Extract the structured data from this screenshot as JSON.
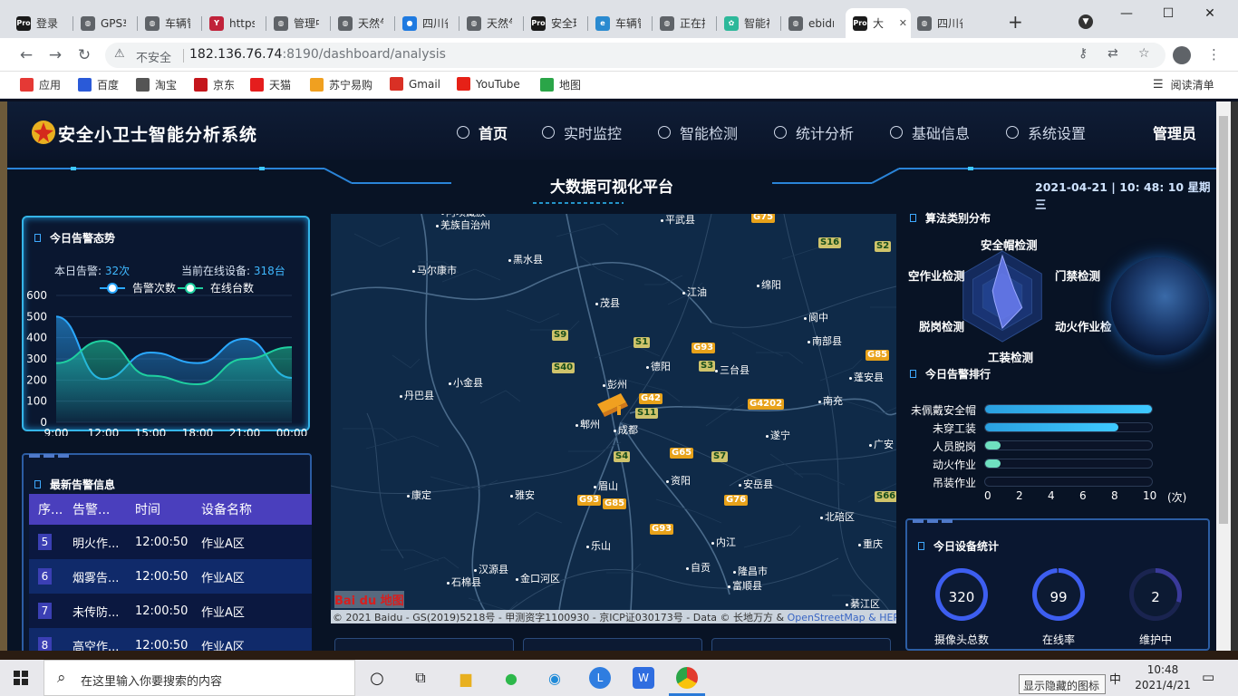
{
  "browser": {
    "tabs": [
      {
        "title": "登录 -",
        "icon": "pro"
      },
      {
        "title": "GPS车",
        "icon": "globe"
      },
      {
        "title": "车辆管",
        "icon": "globe"
      },
      {
        "title": "https:",
        "icon": "yen"
      },
      {
        "title": "管理中",
        "icon": "globe"
      },
      {
        "title": "天然气",
        "icon": "globe"
      },
      {
        "title": "四川省",
        "icon": "chat"
      },
      {
        "title": "天然气",
        "icon": "globe"
      },
      {
        "title": "安全环",
        "icon": "pro"
      },
      {
        "title": "车辆管",
        "icon": "edge"
      },
      {
        "title": "正在接",
        "icon": "globe"
      },
      {
        "title": "智能视",
        "icon": "leaf"
      },
      {
        "title": "ebidn",
        "icon": "globe"
      },
      {
        "title": "大",
        "icon": "pro",
        "active": true
      },
      {
        "title": "四川省",
        "icon": "globe"
      }
    ],
    "new_tab": "+",
    "not_secure": "不安全",
    "url_host": "182.136.76.74",
    "url_rest": ":8190/dashboard/analysis",
    "bookmarks": [
      "应用",
      "百度",
      "淘宝",
      "京东",
      "天猫",
      "苏宁易购",
      "Gmail",
      "YouTube",
      "地图"
    ],
    "reading_list": "阅读清单"
  },
  "app": {
    "title": "安全小卫士智能分析系统",
    "nav": [
      "首页",
      "实时监控",
      "智能检测",
      "统计分析",
      "基础信息",
      "系统设置"
    ],
    "user": "管理员",
    "platform": "大数据可视化平台",
    "datetime": "2021-04-21 | 10: 48: 10 星期三"
  },
  "trend": {
    "title": "今日告警态势",
    "alarm_label": "本日告警:",
    "alarm_value": "32次",
    "online_label": "当前在线设备:",
    "online_value": "318台",
    "legend": [
      "告警次数",
      "在线台数"
    ]
  },
  "chart_data": {
    "type": "area",
    "categories": [
      "9:00",
      "12:00",
      "15:00",
      "18:00",
      "21:00",
      "00:00"
    ],
    "ylim": [
      0,
      600
    ],
    "yticks": [
      0,
      100,
      200,
      300,
      400,
      500,
      600
    ],
    "series": [
      {
        "name": "告警次数",
        "color": "#2aa8ff",
        "values": [
          500,
          205,
          330,
          280,
          395,
          210
        ]
      },
      {
        "name": "在线台数",
        "color": "#1fd0a0",
        "values": [
          280,
          385,
          220,
          180,
          300,
          355
        ]
      }
    ]
  },
  "latest": {
    "title": "最新告警信息",
    "headers": [
      "序...",
      "告警...",
      "时间",
      "设备名称"
    ],
    "rows": [
      {
        "no": "5",
        "type": "明火作...",
        "time": "12:00:50",
        "device": "作业A区"
      },
      {
        "no": "6",
        "type": "烟雾告...",
        "time": "12:00:50",
        "device": "作业A区"
      },
      {
        "no": "7",
        "type": "未传防...",
        "time": "12:00:50",
        "device": "作业A区"
      },
      {
        "no": "8",
        "type": "高空作...",
        "time": "12:00:50",
        "device": "作业A区"
      }
    ]
  },
  "map": {
    "cities": [
      "平武县",
      "马尔康市",
      "黑水县",
      "茂县",
      "江油",
      "阆中",
      "南部县",
      "绵阳",
      "德阳",
      "三台县",
      "彭州",
      "蓬安县",
      "小金县",
      "丹巴县",
      "郫州",
      "成都",
      "南充",
      "遂宁",
      "广安",
      "康定",
      "雅安",
      "眉山",
      "资阳",
      "安岳县",
      "乐山",
      "内江",
      "北碚区",
      "重庆",
      "汉源县",
      "金口河区",
      "自贡",
      "隆昌市",
      "石棉县",
      "富顺县",
      "綦江区",
      "阿坝藏族",
      "羌族自治州"
    ],
    "roads": [
      "G75",
      "S16",
      "S2",
      "S9",
      "S1",
      "G93",
      "G85",
      "G42",
      "S3",
      "S40",
      "G4202",
      "S11",
      "G65",
      "S7",
      "S4",
      "G76",
      "S66",
      "G93",
      "G85",
      "G93"
    ],
    "logo": "Bai du 地图",
    "credit": "© 2021 Baidu - GS(2019)5218号 - 甲测资字1100930 - 京ICP证030173号 - Data © 长地万方 &",
    "credit_link": "OpenStreetMap",
    "credit_tail": "& HER"
  },
  "radar": {
    "title": "算法类别分布",
    "labels": [
      "安全帽检测",
      "门禁检测",
      "动火作业检",
      "工装检测",
      "脱岗检测",
      "空作业检测"
    ]
  },
  "rank": {
    "title": "今日告警排行",
    "items": [
      {
        "name": "未佩戴安全帽",
        "value": 10
      },
      {
        "name": "未穿工装",
        "value": 8
      },
      {
        "name": "人员脱岗",
        "value": 1
      },
      {
        "name": "动火作业",
        "value": 1
      },
      {
        "name": "吊装作业",
        "value": 0
      }
    ],
    "axis": [
      "0",
      "2",
      "4",
      "6",
      "8",
      "10"
    ],
    "unit": "(次)"
  },
  "devices": {
    "title": "今日设备统计",
    "items": [
      {
        "value": "320",
        "label": "摄像头总数"
      },
      {
        "value": "99",
        "label": "在线率"
      },
      {
        "value": "2",
        "label": "维护中"
      }
    ]
  },
  "taskbar": {
    "search": "在这里输入你要搜索的内容",
    "ime": "中",
    "time": "10:48",
    "date": "2021/4/21",
    "tooltip": "显示隐藏的图标"
  }
}
